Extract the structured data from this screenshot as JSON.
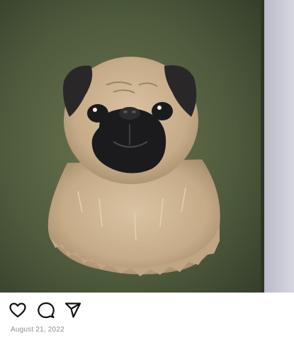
{
  "post": {
    "image_subject": "painting-of-pug",
    "date": "August 21, 2022"
  },
  "actions": {
    "like_icon": "heart-icon",
    "comment_icon": "comment-bubble-icon",
    "share_icon": "paper-plane-icon"
  },
  "colors": {
    "canvas_green": "#4c5b3b",
    "wall_gray": "#c8c9d3",
    "fur": "#c9b08f",
    "muzzle": "#1b1a1c",
    "date_text": "#8e8e8e"
  }
}
